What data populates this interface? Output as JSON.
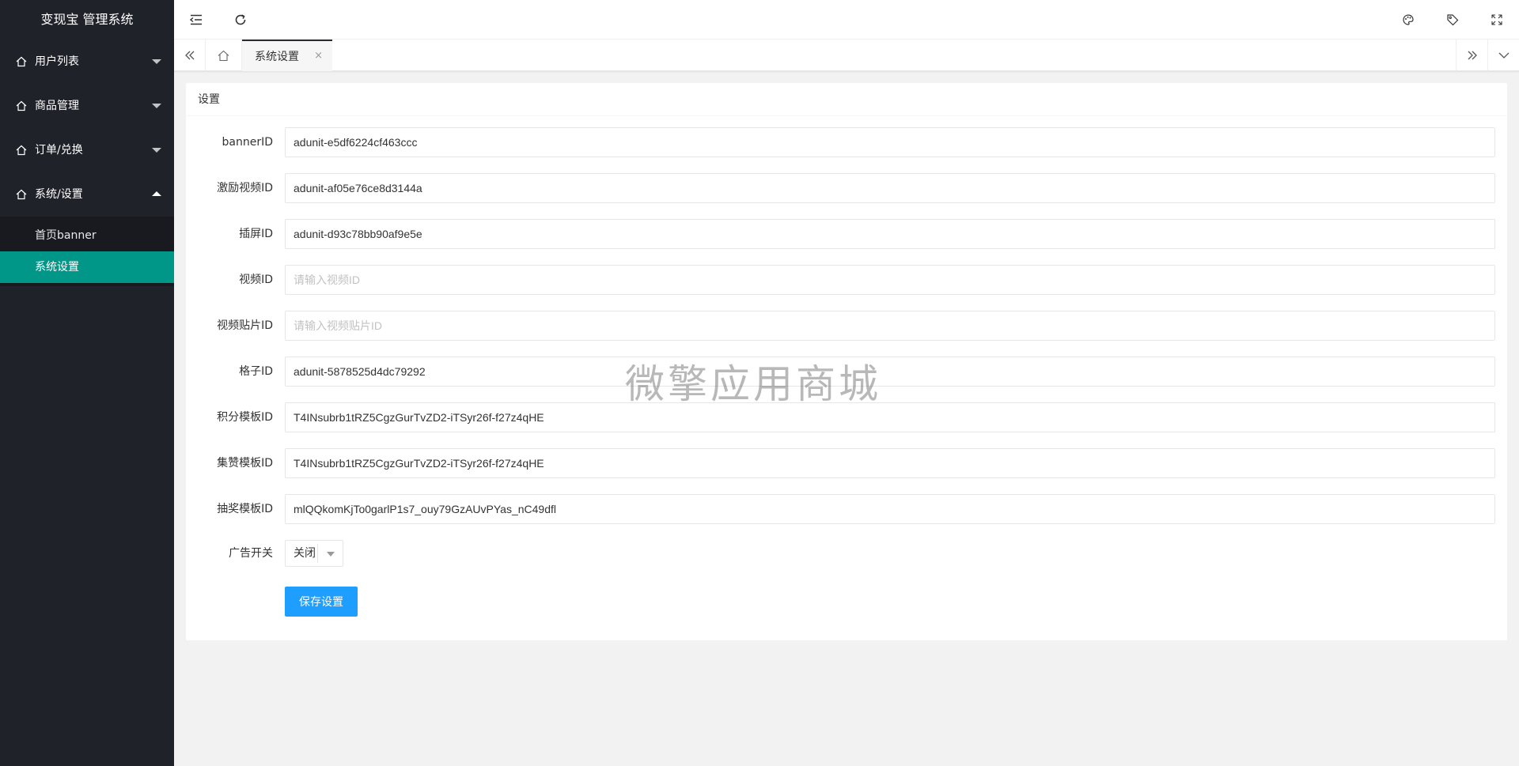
{
  "app": {
    "title": "变现宝 管理系统"
  },
  "sidebar": {
    "items": [
      {
        "label": "用户列表",
        "icon": "home-icon",
        "expanded": false
      },
      {
        "label": "商品管理",
        "icon": "home-icon",
        "expanded": false
      },
      {
        "label": "订单/兑换",
        "icon": "home-icon",
        "expanded": false
      },
      {
        "label": "系统/设置",
        "icon": "home-icon",
        "expanded": true,
        "children": [
          {
            "label": "首页banner",
            "active": false
          },
          {
            "label": "系统设置",
            "active": true
          }
        ]
      }
    ]
  },
  "header": {
    "left_icons": [
      "menu-collapse-icon",
      "refresh-icon"
    ],
    "right_icons": [
      "theme-palette-icon",
      "tag-icon",
      "fullscreen-icon"
    ]
  },
  "tabs": {
    "items": [
      {
        "label": "系统设置",
        "close": "×"
      }
    ]
  },
  "card": {
    "title": "设置",
    "fields": [
      {
        "label": "bannerID",
        "value": "adunit-e5df6224cf463ccc",
        "placeholder": ""
      },
      {
        "label": "激励视频ID",
        "value": "adunit-af05e76ce8d3144a",
        "placeholder": ""
      },
      {
        "label": "插屏ID",
        "value": "adunit-d93c78bb90af9e5e",
        "placeholder": ""
      },
      {
        "label": "视频ID",
        "value": "",
        "placeholder": "请输入视频ID"
      },
      {
        "label": "视频贴片ID",
        "value": "",
        "placeholder": "请输入视频贴片ID"
      },
      {
        "label": "格子ID",
        "value": "adunit-5878525d4dc79292",
        "placeholder": ""
      },
      {
        "label": "积分模板ID",
        "value": "T4INsubrb1tRZ5CgzGurTvZD2-iTSyr26f-f27z4qHE",
        "placeholder": ""
      },
      {
        "label": "集赞模板ID",
        "value": "T4INsubrb1tRZ5CgzGurTvZD2-iTSyr26f-f27z4qHE",
        "placeholder": ""
      },
      {
        "label": "抽奖模板ID",
        "value": "mlQQkomKjTo0garlP1s7_ouy79GzAUvPYas_nC49dfl",
        "placeholder": ""
      }
    ],
    "ad_switch": {
      "label": "广告开关",
      "value": "关闭"
    },
    "save_label": "保存设置"
  },
  "watermark": "微擎应用商城",
  "colors": {
    "sidebar_bg": "#20222a",
    "active": "#009688",
    "primary_button": "#1e9fff"
  }
}
